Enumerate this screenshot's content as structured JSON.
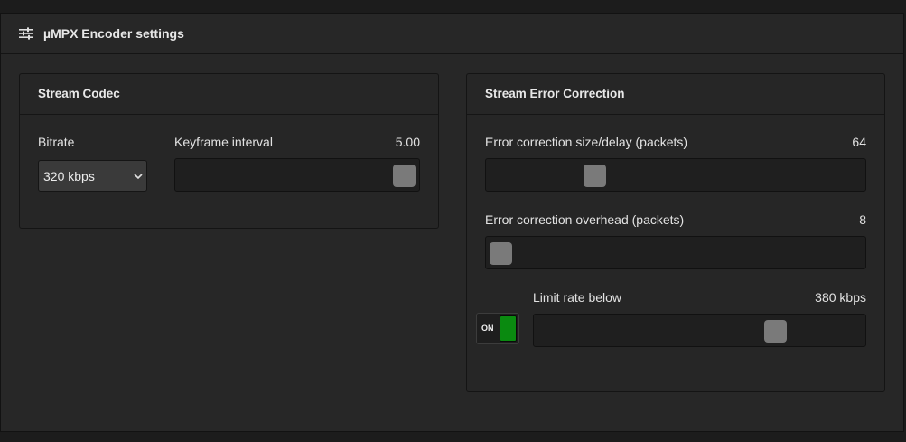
{
  "panel": {
    "title": "µMPX Encoder settings",
    "icon": "sliders-icon"
  },
  "stream_codec": {
    "title": "Stream Codec",
    "bitrate": {
      "label": "Bitrate",
      "selected": "320 kbps"
    },
    "keyframe_interval": {
      "label": "Keyframe interval",
      "value_text": "5.00",
      "level_percent": 100
    }
  },
  "stream_error_correction": {
    "title": "Stream Error Correction",
    "size_delay": {
      "label": "Error correction size/delay (packets)",
      "value_text": "64",
      "level_percent": 27
    },
    "overhead": {
      "label": "Error correction overhead (packets)",
      "value_text": "8",
      "level_percent": 0
    },
    "limit_rate": {
      "label": "Limit rate below",
      "value_text": "380 kbps",
      "level_percent": 75,
      "toggle_label": "ON",
      "toggle_on": true
    }
  },
  "colors": {
    "toggle_on": "#0a8a10",
    "thumb": "#7a7a7a"
  }
}
